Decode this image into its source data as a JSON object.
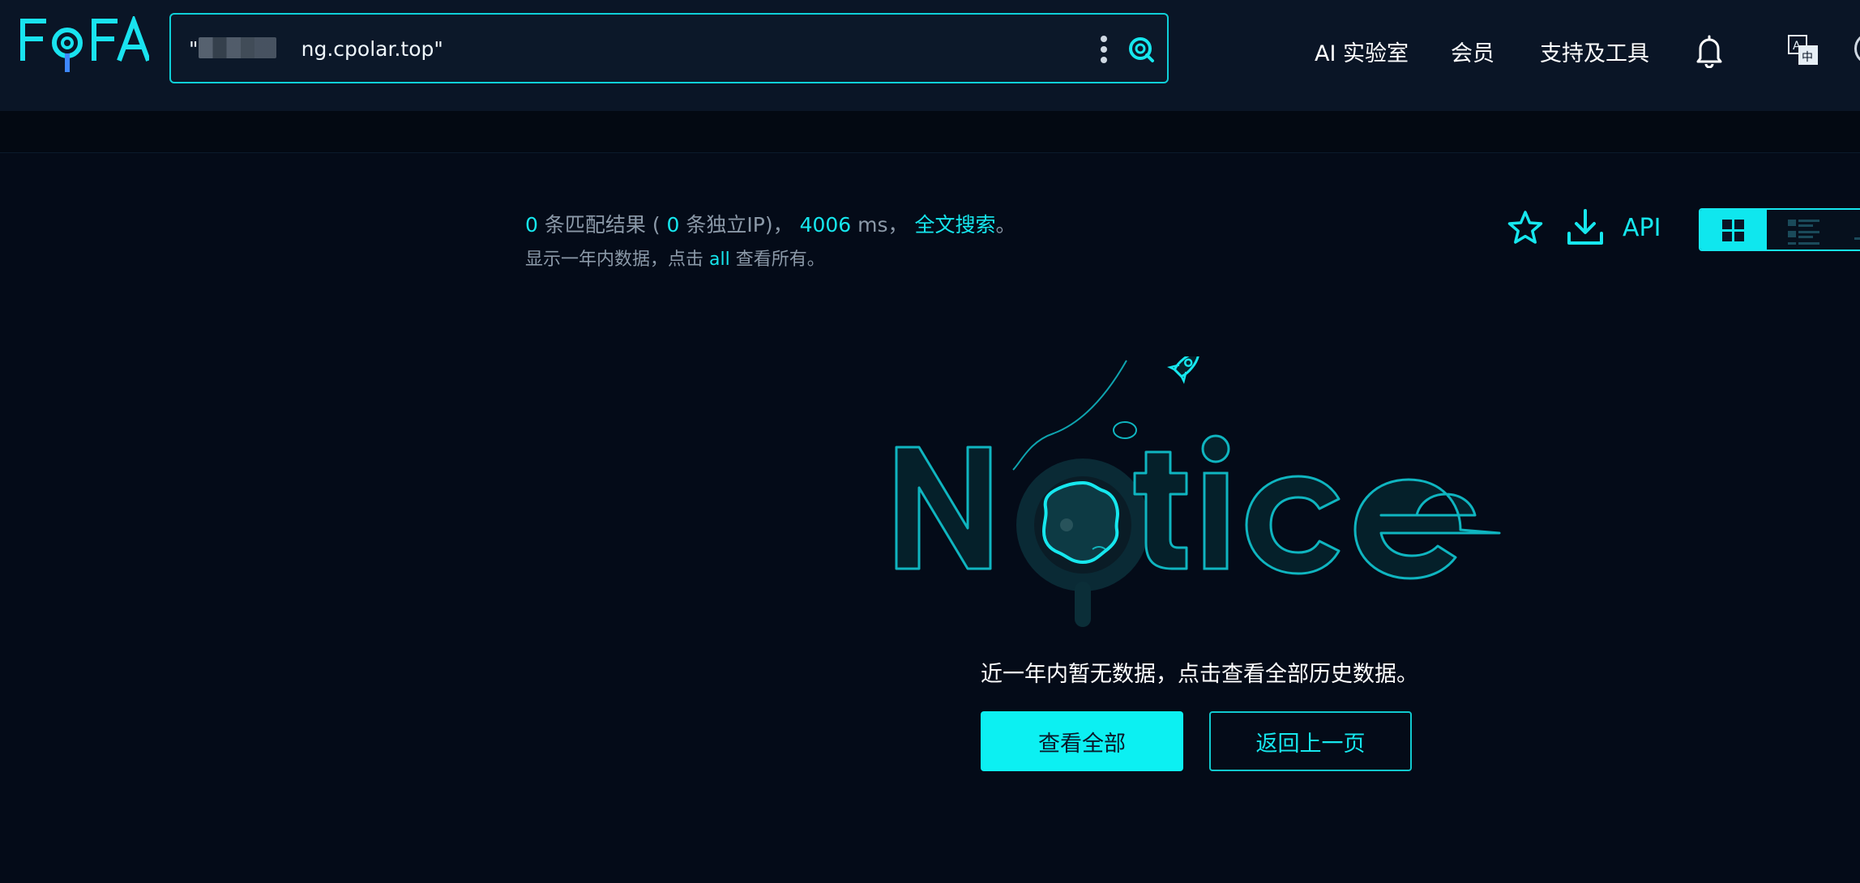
{
  "header": {
    "logo_text": "FOFA",
    "search": {
      "value": "\"                ng.cpolar.top\""
    },
    "nav": [
      "AI 实验室",
      "会员",
      "支持及工具"
    ],
    "icons": {
      "more": "more-vertical-icon",
      "search": "search-icon",
      "notifications": "bell-icon",
      "language": "translate-icon",
      "user": "avatar-icon"
    }
  },
  "results": {
    "match_count": "0",
    "match_label": "条匹配结果",
    "paren_open": "(",
    "ip_count": "0",
    "ip_label": "条独立IP",
    "paren_close": ")，",
    "time_value": "4006",
    "time_unit": "ms，",
    "fulltext_link": "全文搜索",
    "period": "。",
    "note_prefix": "显示一年内数据，点击",
    "note_link": "all",
    "note_suffix": "查看所有。"
  },
  "toolbar": {
    "api_label": "API",
    "icons": {
      "favorite": "star-icon",
      "download": "download-icon",
      "grid_view": "grid-view-icon",
      "list_view": "list-view-icon"
    },
    "active_view": "grid"
  },
  "empty_state": {
    "illustration_text": "Notice",
    "message": "近一年内暂无数据，点击查看全部历史数据。",
    "primary_button": "查看全部",
    "secondary_button": "返回上一页"
  },
  "colors": {
    "accent": "#16e7ee",
    "background": "#040b18",
    "header_bg": "#0a1526",
    "text_primary": "#ffffff",
    "text_muted": "#8b99a8"
  }
}
